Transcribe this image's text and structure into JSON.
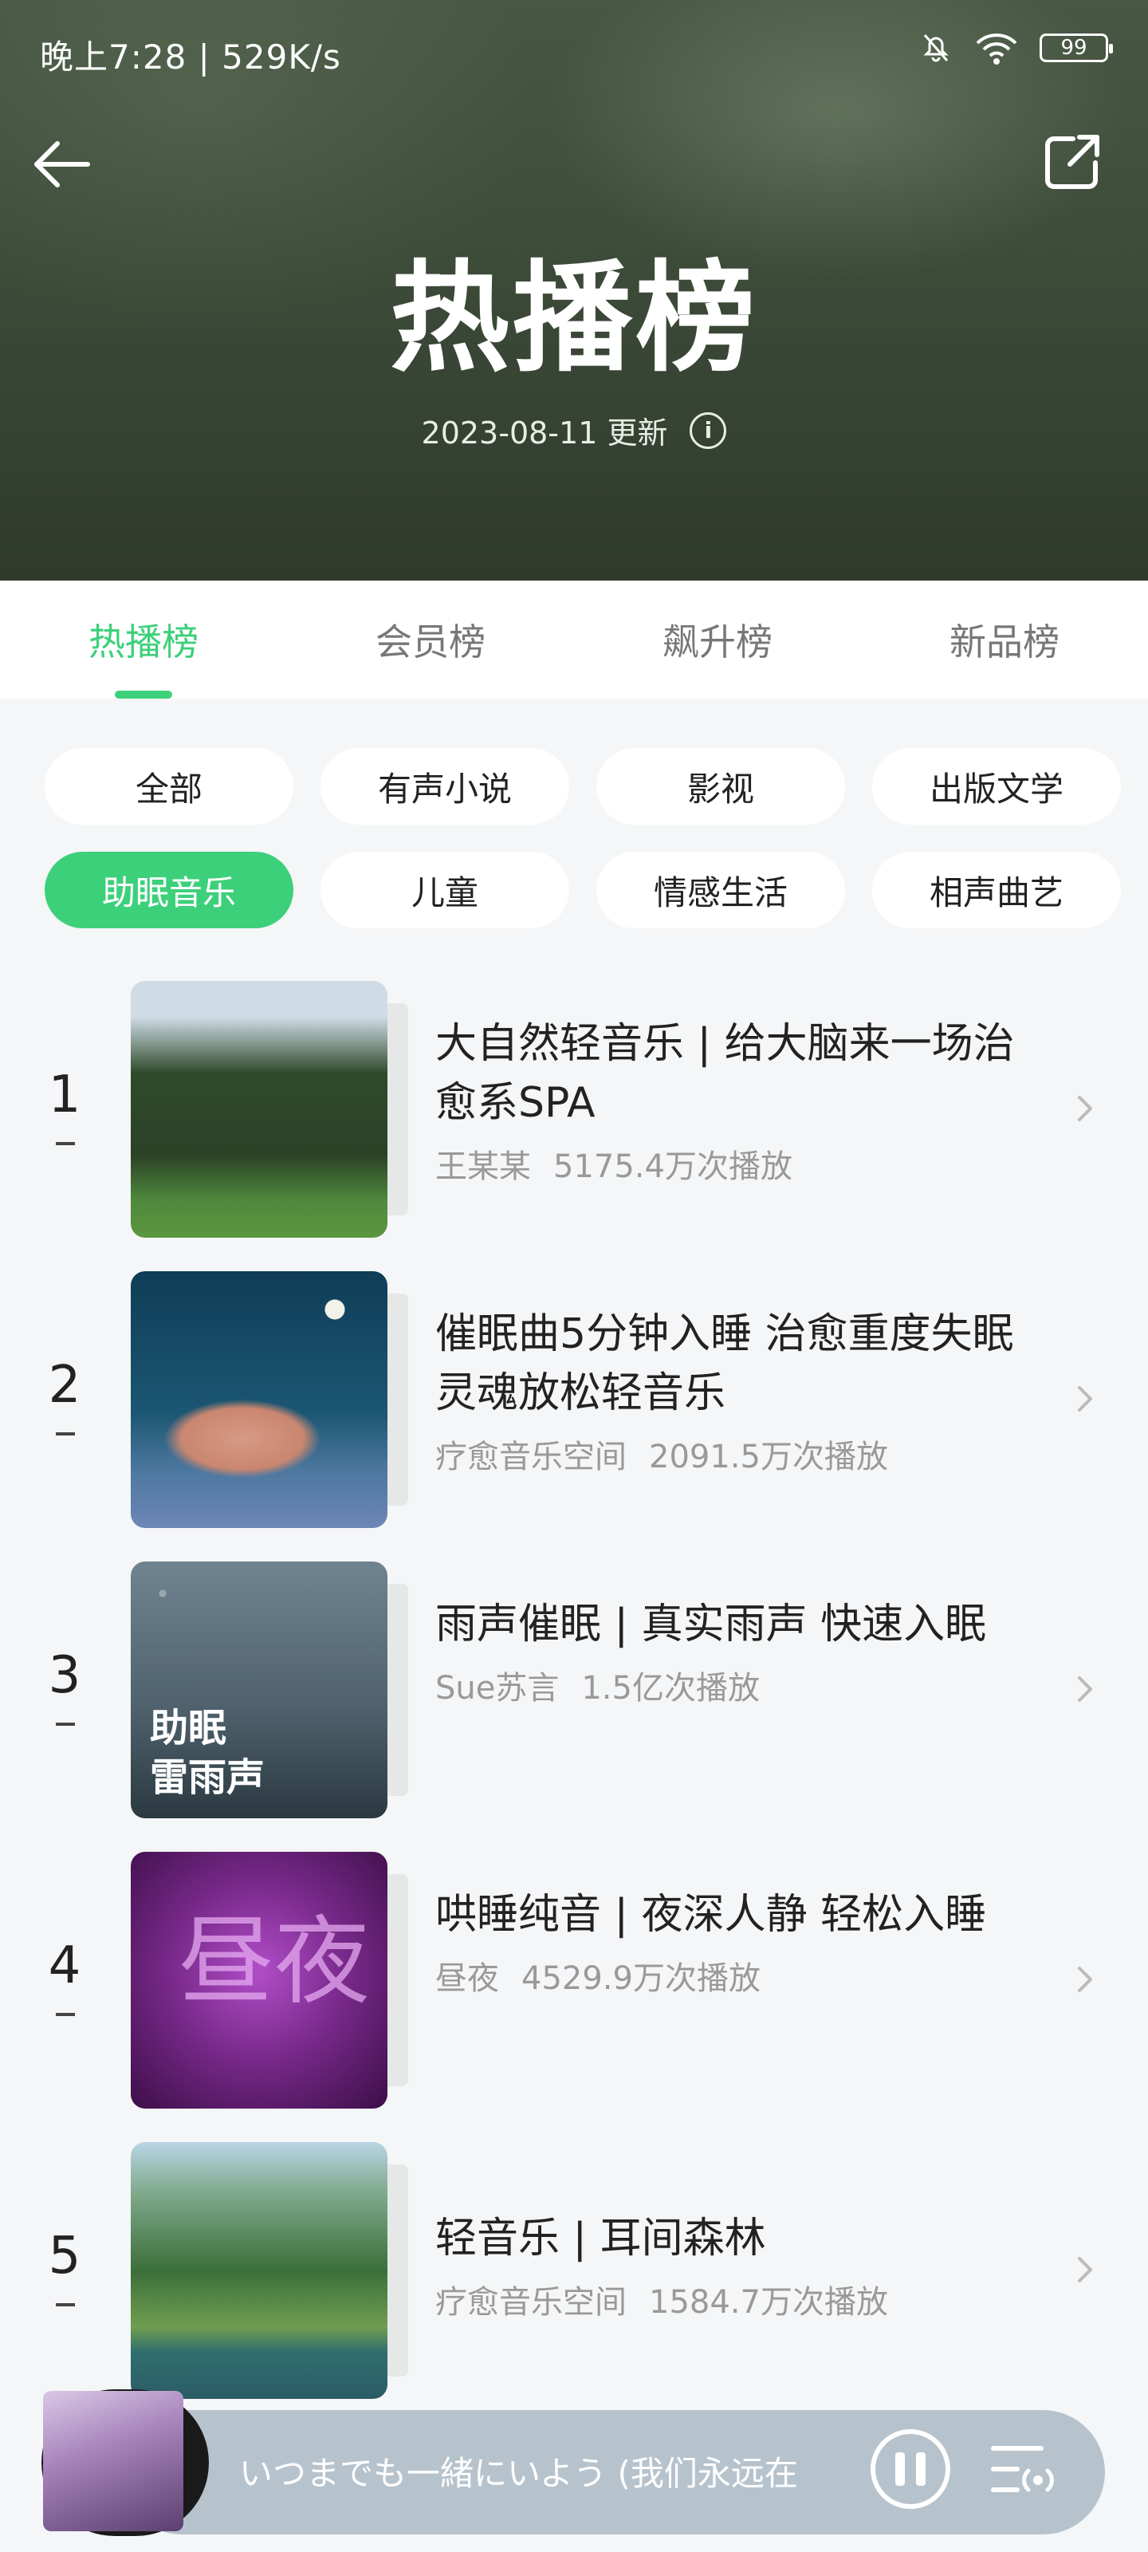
{
  "status_bar": {
    "time_speed": "晚上7:28 | 529K/s",
    "battery": "99"
  },
  "header": {
    "title": "热播榜",
    "updated": "2023-08-11 更新",
    "info_glyph": "i"
  },
  "tabs": [
    {
      "label": "热播榜",
      "active": true
    },
    {
      "label": "会员榜",
      "active": false
    },
    {
      "label": "飙升榜",
      "active": false
    },
    {
      "label": "新品榜",
      "active": false
    }
  ],
  "filters": [
    {
      "label": "全部",
      "active": false
    },
    {
      "label": "有声小说",
      "active": false
    },
    {
      "label": "影视",
      "active": false
    },
    {
      "label": "出版文学",
      "active": false
    },
    {
      "label": "助眠音乐",
      "active": true
    },
    {
      "label": "儿童",
      "active": false
    },
    {
      "label": "情感生活",
      "active": false
    },
    {
      "label": "相声曲艺",
      "active": false
    }
  ],
  "list": [
    {
      "rank": "1",
      "title": "大自然轻音乐 | 给大脑来一场治愈系SPA",
      "author": "王某某",
      "plays": "5175.4万次播放"
    },
    {
      "rank": "2",
      "title": "催眠曲5分钟入睡 治愈重度失眠 灵魂放松轻音乐",
      "author": "疗愈音乐空间",
      "plays": "2091.5万次播放"
    },
    {
      "rank": "3",
      "title": "雨声催眠 | 真实雨声 快速入眠",
      "author": "Sue苏言",
      "plays": "1.5亿次播放",
      "cover_text_1": "助眠",
      "cover_text_2": "雷雨声"
    },
    {
      "rank": "4",
      "title": "哄睡纯音 | 夜深人静 轻松入睡",
      "author": "昼夜",
      "plays": "4529.9万次播放",
      "cover_text": "昼夜"
    },
    {
      "rank": "5",
      "title": "轻音乐 | 耳间森林",
      "author": "疗愈音乐空间",
      "plays": "1584.7万次播放"
    }
  ],
  "player": {
    "now_playing": "いつまでも一緒にいよう (我们永远在"
  }
}
